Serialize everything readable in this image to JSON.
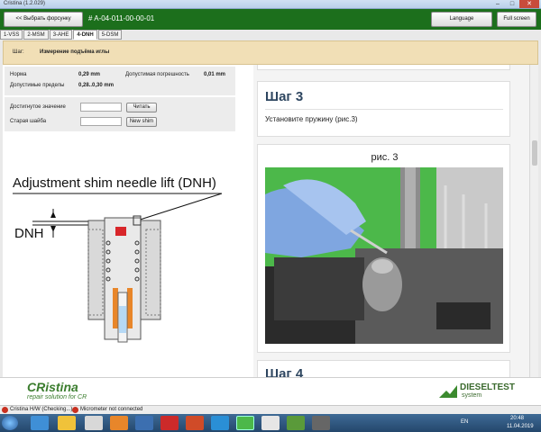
{
  "window": {
    "title": "Cristina (1.2.029)"
  },
  "header": {
    "back_label": "<< Выбрать форсунку",
    "injector_code": "# A-04-011-00-00-01",
    "language_label": "Language",
    "fullscreen_label": "Full screen"
  },
  "tabs": [
    {
      "label": "1-VSS"
    },
    {
      "label": "2-MSM"
    },
    {
      "label": "3-AHE"
    },
    {
      "label": "4-DNH"
    },
    {
      "label": "5-DSM"
    }
  ],
  "step": {
    "label": "Шаг:",
    "value": "Измерение подъёма иглы"
  },
  "info": {
    "norm_label": "Норма",
    "norm_value": "0,29 mm",
    "tolerance_label": "Допустимая погрешность",
    "tolerance_value": "0,01 mm",
    "limits_label": "Допустимые пределы",
    "limits_value": "0,28..0,30 mm"
  },
  "inputs": {
    "reached_label": "Достигнутое значение",
    "read_label": "Читать",
    "old_shim_label": "Старая шайба",
    "new_shim_label": "New shim"
  },
  "diagram": {
    "title": "Adjustment shim needle lift (DNH)",
    "label": "DNH"
  },
  "instructions": {
    "step_title": "Шаг 3",
    "step_text": "Установите пружину (рис.3)",
    "figure_caption": "рис. 3",
    "next_step_partial": "Шаг 4"
  },
  "footer": {
    "brand": "CRistina",
    "brand_tagline": "repair solution for CR",
    "logo_text": "DIESELTEST",
    "logo_sub": "system"
  },
  "status": {
    "item1": "Cristina H/W (Checking...)",
    "item2": "Micrometer not connected"
  },
  "taskbar": {
    "lang": "EN",
    "time": "20:48",
    "date": "11.04.2019"
  },
  "colors": {
    "header_green": "#1c6f1c",
    "step_bg": "#f1dfb6",
    "status_red": "#c83020"
  }
}
